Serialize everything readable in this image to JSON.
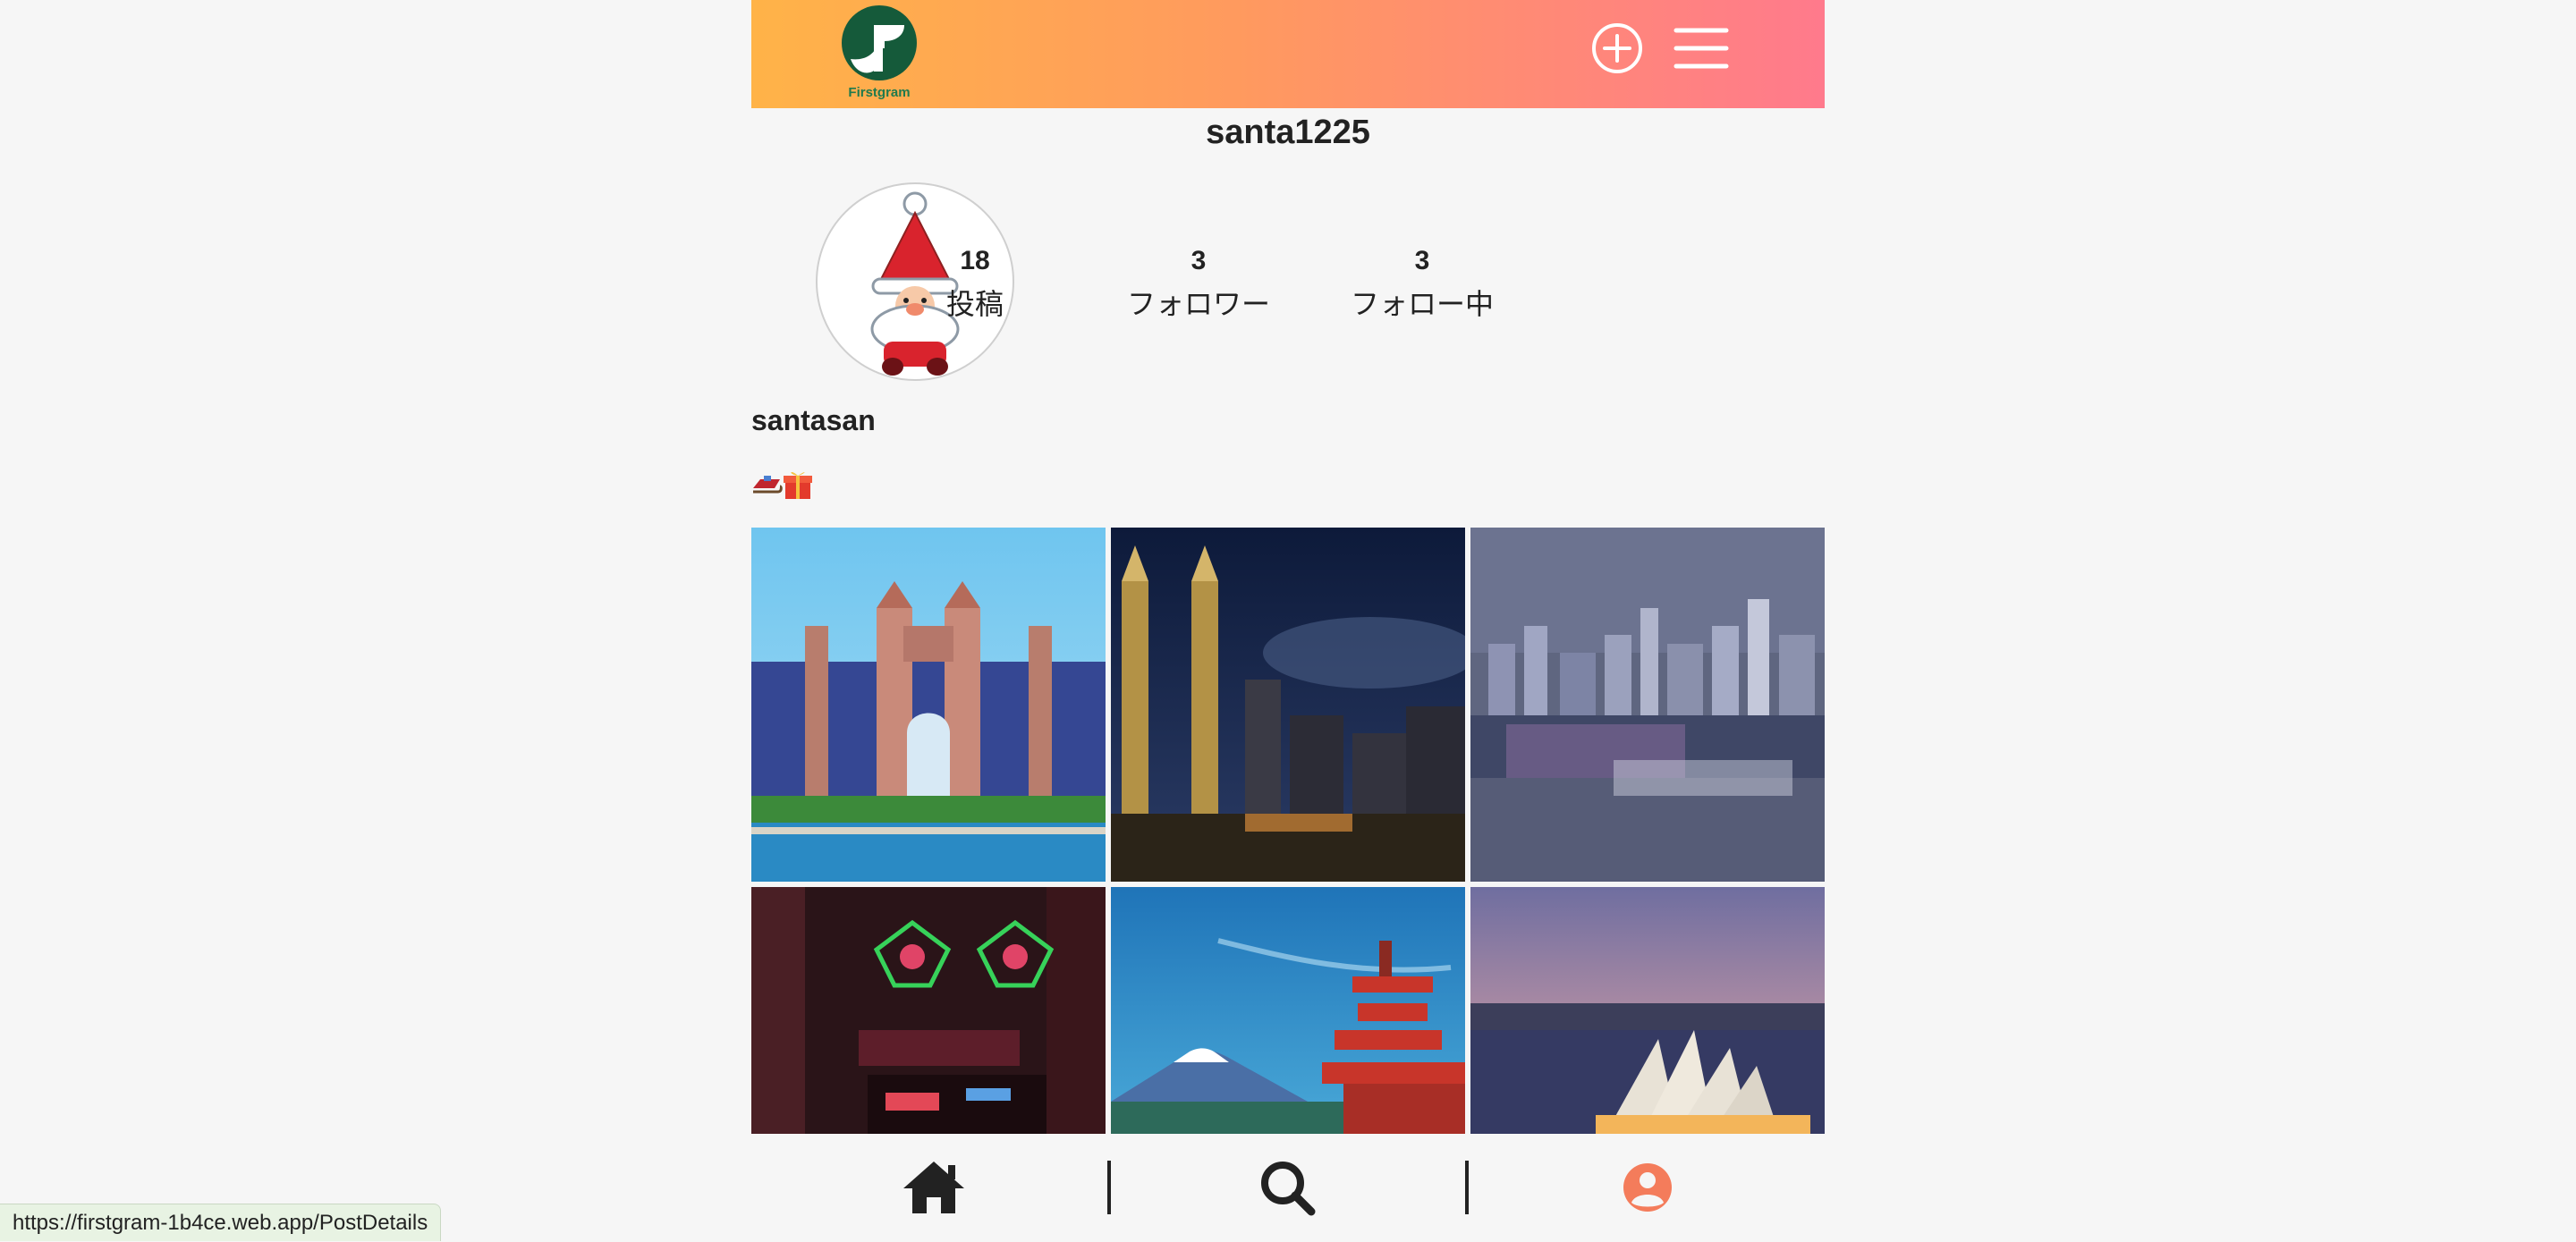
{
  "header": {
    "logo_text": "Firstgram",
    "logo_icon": "firstgram-logo-icon",
    "add_icon": "plus-circle-icon",
    "menu_icon": "hamburger-menu-icon",
    "brand_gradient": [
      "#ffb348",
      "#ff7a8c"
    ]
  },
  "profile": {
    "username": "santa1225",
    "display_name": "santasan",
    "bio": "🛷🎁",
    "stats": {
      "posts": {
        "count": "18",
        "label": "投稿"
      },
      "followers": {
        "count": "3",
        "label": "フォロワー"
      },
      "following": {
        "count": "3",
        "label": "フォロー中"
      }
    }
  },
  "posts": [
    {
      "subject": "atlantis-resort-photo"
    },
    {
      "subject": "petronas-towers-night-photo"
    },
    {
      "subject": "hong-kong-skyline-photo"
    },
    {
      "subject": "neon-street-photo"
    },
    {
      "subject": "mount-fuji-pagoda-photo"
    },
    {
      "subject": "sydney-opera-house-photo"
    }
  ],
  "bottom_nav": {
    "home_icon": "home-icon",
    "search_icon": "search-icon",
    "profile_icon": "user-profile-icon",
    "active_color": "#f47c5b"
  },
  "status_bar": {
    "url": "https://firstgram-1b4ce.web.app/PostDetails"
  }
}
